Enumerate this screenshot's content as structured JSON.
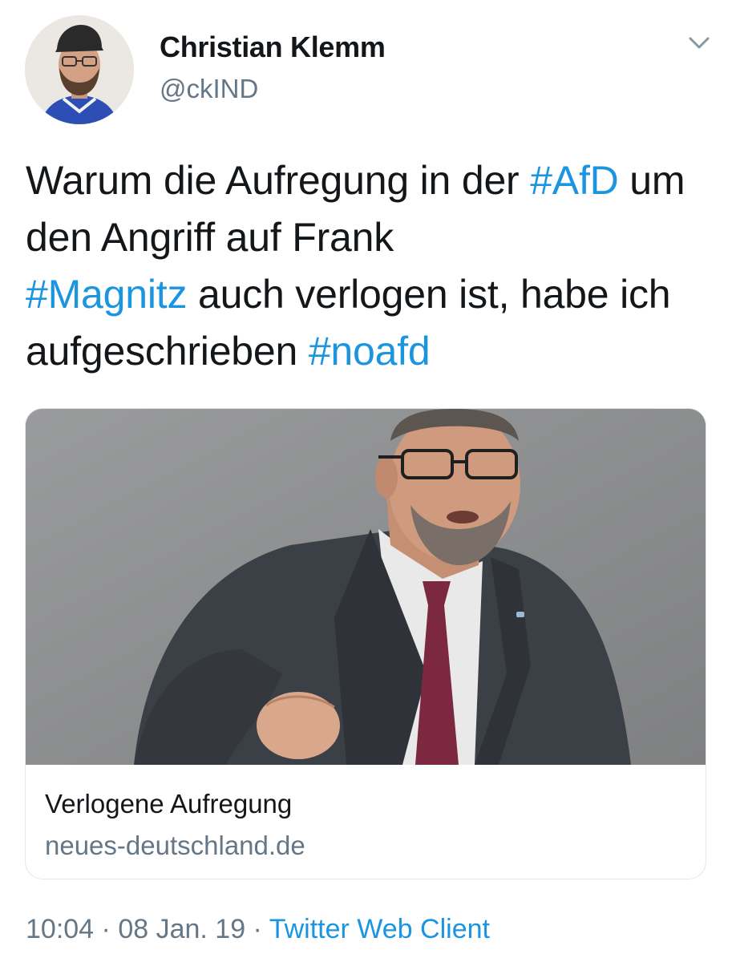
{
  "tweet": {
    "author": {
      "display_name": "Christian Klemm",
      "handle": "@ckIND",
      "avatar_icon": "avatar-photo"
    },
    "menu_icon": "chevron-down-icon",
    "text_segments": [
      {
        "type": "text",
        "value": "Warum die Aufregung in der "
      },
      {
        "type": "hashtag",
        "value": "#AfD"
      },
      {
        "type": "text",
        "value": " um den Angriff auf Frank "
      },
      {
        "type": "hashtag",
        "value": "#Magnitz"
      },
      {
        "type": "text",
        "value": " auch verlogen ist, habe ich aufgeschrieben "
      },
      {
        "type": "hashtag",
        "value": "#noafd"
      }
    ],
    "link_card": {
      "title": "Verlogene Aufregung",
      "domain": "neues-deutschland.de"
    },
    "meta": {
      "time": "10:04",
      "separator": " · ",
      "date": "08 Jan. 19",
      "separator2": " · ",
      "source": "Twitter Web Client"
    }
  },
  "colors": {
    "text": "#14171a",
    "secondary": "#657786",
    "link": "#1b95e0",
    "border": "#e1e8ed"
  }
}
